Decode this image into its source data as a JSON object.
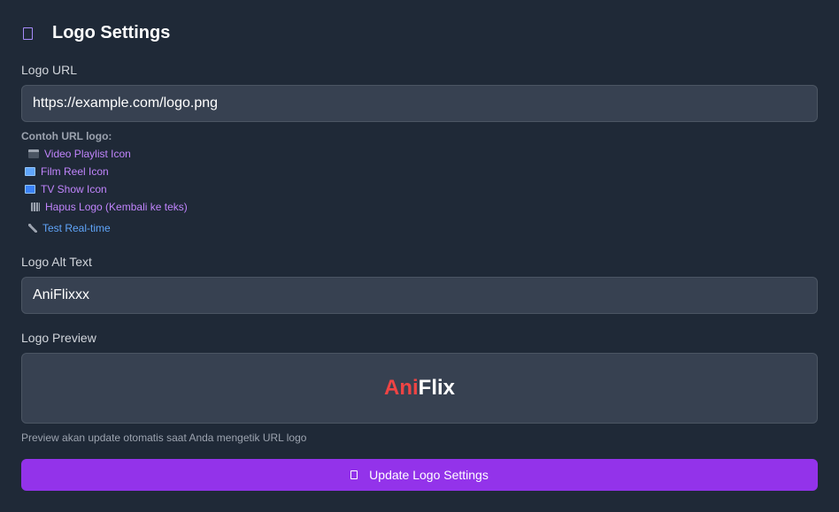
{
  "header": {
    "title": "Logo Settings",
    "icon": "image-icon"
  },
  "logo_url": {
    "label": "Logo URL",
    "value": "https://example.com/logo.png"
  },
  "examples": {
    "title": "Contoh URL logo:",
    "items": [
      {
        "label": "Video Playlist Icon",
        "icon": "video-playlist-icon"
      },
      {
        "label": "Film Reel Icon",
        "icon": "film-reel-icon"
      },
      {
        "label": "TV Show Icon",
        "icon": "tv-icon"
      },
      {
        "label": "Hapus Logo (Kembali ke teks)",
        "icon": "trash-icon"
      }
    ],
    "test_label": "Test Real-time"
  },
  "alt_text": {
    "label": "Logo Alt Text",
    "value": "AniFlixxx"
  },
  "preview": {
    "label": "Logo Preview",
    "brand_part1": "Ani",
    "brand_part2": "Flix",
    "hint": "Preview akan update otomatis saat Anda mengetik URL logo"
  },
  "submit": {
    "label": "Update Logo Settings",
    "icon": "save-icon"
  },
  "colors": {
    "background": "#1f2937",
    "field": "#374151",
    "accent": "#9333ea",
    "link": "#c084fc",
    "brand_red": "#ef4444"
  }
}
